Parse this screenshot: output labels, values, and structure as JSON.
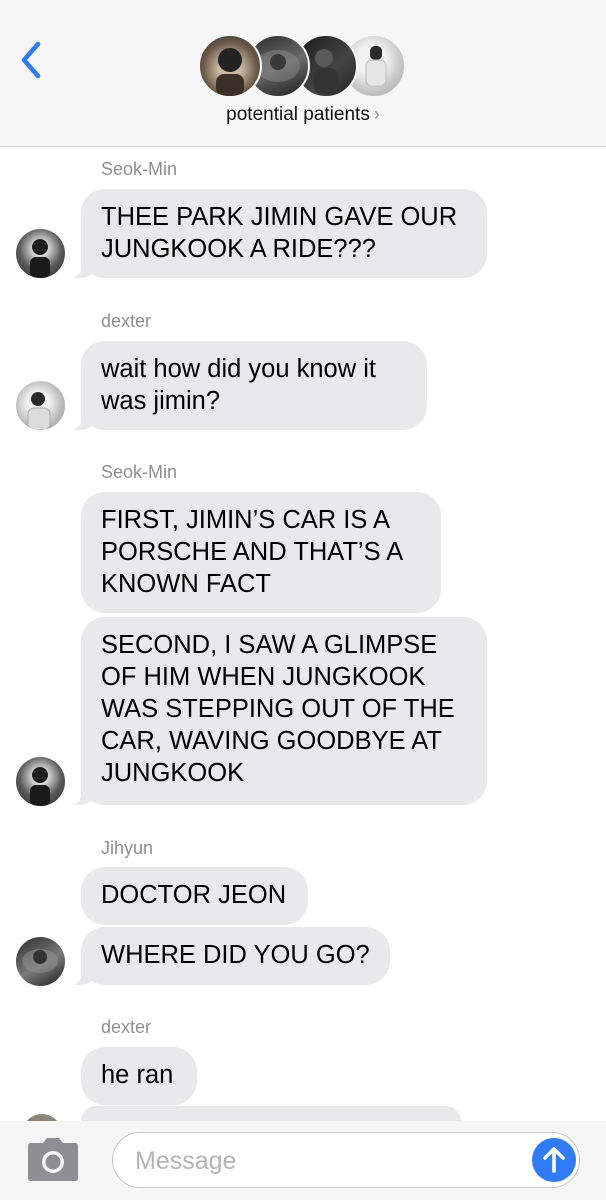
{
  "header": {
    "title": "potential patients",
    "back_icon": "chevron-left-icon",
    "accent": "#2f7cf6",
    "participants": 4
  },
  "messages": [
    {
      "sender": "Seok-Min",
      "bubbles": [
        "THEE PARK JIMIN GAVE OUR\nJUNGKOOK A RIDE???"
      ]
    },
    {
      "sender": "dexter",
      "bubbles": [
        "wait how did you know it\nwas jimin?"
      ]
    },
    {
      "sender": "Seok-Min",
      "bubbles": [
        "FIRST, JIMIN’S CAR IS A\nPORSCHE AND THAT’S A\nKNOWN FACT",
        "SECOND, I SAW A GLIMPSE\nOF HIM WHEN JUNGKOOK\nWAS STEPPING OUT OF THE\nCAR, WAVING GOODBYE AT\nJUNGKOOK"
      ]
    },
    {
      "sender": "Jihyun",
      "bubbles": [
        "DOCTOR JEON",
        "WHERE DID YOU GO?"
      ]
    },
    {
      "sender": "dexter",
      "bubbles": [
        "he ran"
      ]
    }
  ],
  "compose": {
    "placeholder": "Message",
    "camera_icon": "camera-icon",
    "send_icon": "arrow-up-icon",
    "send_color": "#2f7cf6"
  }
}
